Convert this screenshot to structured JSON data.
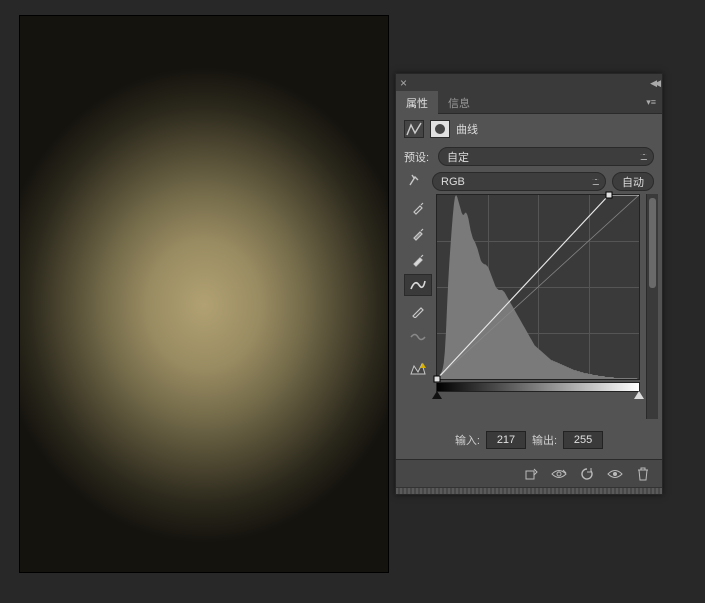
{
  "tabs": {
    "properties": "属性",
    "info": "信息"
  },
  "adjustment": {
    "title": "曲线"
  },
  "preset": {
    "label": "预设:",
    "value": "自定"
  },
  "channel": {
    "value": "RGB",
    "auto": "自动"
  },
  "curves": {
    "input_label": "输入:",
    "input_value": "217",
    "output_label": "输出:",
    "output_value": "255",
    "point_black": {
      "x": 0,
      "y": 0
    },
    "point_white": {
      "x": 217,
      "y": 255
    }
  },
  "chart_data": {
    "type": "area",
    "title": "",
    "xlabel": "输入",
    "ylabel": "输出",
    "xlim": [
      0,
      255
    ],
    "ylim": [
      0,
      255
    ],
    "series": [
      {
        "name": "curve",
        "x": [
          0,
          217,
          255
        ],
        "y": [
          0,
          255,
          255
        ]
      },
      {
        "name": "baseline",
        "x": [
          0,
          255
        ],
        "y": [
          0,
          255
        ]
      }
    ],
    "histogram": [
      2,
      3,
      4,
      5,
      7,
      10,
      16,
      28,
      48,
      74,
      98,
      118,
      134,
      150,
      164,
      176,
      184,
      186,
      184,
      180,
      176,
      172,
      168,
      166,
      166,
      168,
      168,
      166,
      162,
      156,
      150,
      146,
      142,
      140,
      138,
      135,
      132,
      128,
      124,
      120,
      118,
      117,
      116,
      116,
      115,
      114,
      112,
      109,
      106,
      103,
      100,
      97,
      94,
      92,
      91,
      90,
      90,
      90,
      90,
      89,
      88,
      86,
      84,
      82,
      80,
      78,
      76,
      74,
      72,
      70,
      68,
      66,
      64,
      62,
      60,
      58,
      56,
      54,
      52,
      50,
      48,
      46,
      44,
      42,
      40,
      38,
      36,
      34,
      33,
      32,
      31,
      30,
      29,
      28,
      27,
      26,
      25,
      24,
      23,
      22,
      21,
      20,
      19,
      19,
      18,
      18,
      17,
      17,
      16,
      16,
      15,
      15,
      14,
      14,
      13,
      13,
      12,
      12,
      11,
      11,
      10,
      10,
      9,
      9,
      9,
      8,
      8,
      8,
      7,
      7,
      7,
      6,
      6,
      6,
      6,
      5,
      5,
      5,
      5,
      4,
      4,
      4,
      4,
      4,
      3,
      3,
      3,
      3,
      3,
      3,
      2,
      2,
      2,
      2,
      2,
      2,
      2,
      2,
      1,
      1,
      1,
      1,
      1,
      1,
      1,
      1,
      1,
      1,
      1,
      1,
      1,
      1,
      1,
      1,
      1,
      1,
      1,
      1,
      1,
      0
    ]
  }
}
